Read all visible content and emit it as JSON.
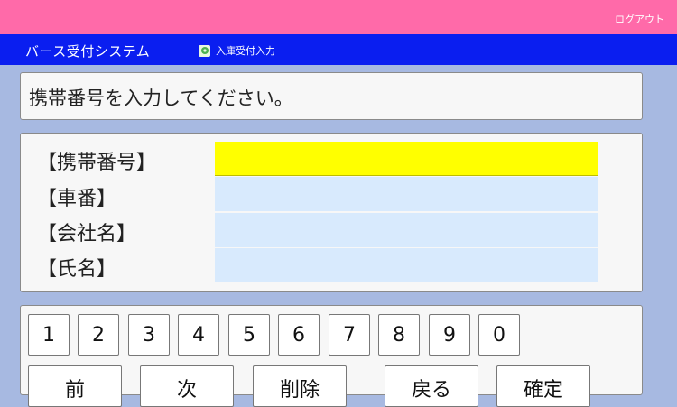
{
  "header": {
    "logout_label": "ログアウト"
  },
  "nav": {
    "system_title": "バース受付システム",
    "menu_item_label": "入庫受付入力",
    "menu_icon": "gear-icon"
  },
  "prompt": {
    "text": "携帯番号を入力してください。"
  },
  "form": {
    "fields": [
      {
        "label": "【携帯番号】",
        "value": ""
      },
      {
        "label": "【車番】",
        "value": ""
      },
      {
        "label": "【会社名】",
        "value": ""
      },
      {
        "label": "【氏名】",
        "value": ""
      }
    ]
  },
  "keypad": {
    "digits": [
      "1",
      "2",
      "3",
      "4",
      "5",
      "6",
      "7",
      "8",
      "9",
      "0"
    ],
    "commands": [
      "前",
      "次",
      "削除",
      "戻る",
      "確定"
    ]
  },
  "colors": {
    "top_bar": "#ff6aa9",
    "nav_bar": "#0a1ef0",
    "active_field": "#ffff00",
    "inactive_field": "#d8eafd",
    "background": "#a7b9e1"
  }
}
